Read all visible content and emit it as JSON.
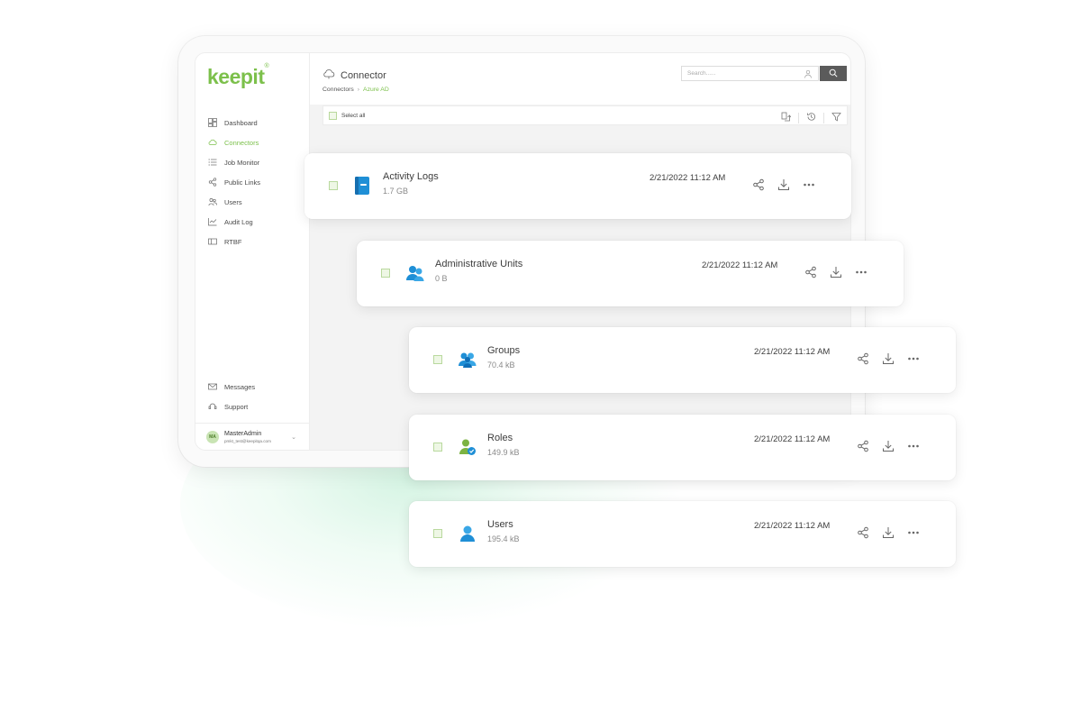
{
  "app": {
    "logo": "keepit",
    "logo_reg": "®"
  },
  "sidebar": {
    "items": [
      {
        "label": "Dashboard",
        "icon": "dashboard-icon",
        "active": false
      },
      {
        "label": "Connectors",
        "icon": "cloud-icon",
        "active": true
      },
      {
        "label": "Job Monitor",
        "icon": "list-icon",
        "active": false
      },
      {
        "label": "Public Links",
        "icon": "share-icon",
        "active": false
      },
      {
        "label": "Users",
        "icon": "users-icon",
        "active": false
      },
      {
        "label": "Audit Log",
        "icon": "audit-icon",
        "active": false
      },
      {
        "label": "RTBF",
        "icon": "rtbf-icon",
        "active": false
      }
    ],
    "bottom_items": [
      {
        "label": "Messages",
        "icon": "mail-icon"
      },
      {
        "label": "Support",
        "icon": "support-icon"
      }
    ],
    "user": {
      "initials": "MA",
      "name": "MasterAdmin",
      "email": "pmkt_test@keepitqa.com"
    }
  },
  "header": {
    "title": "Connector",
    "breadcrumb": [
      "Connectors",
      "Azure AD"
    ],
    "breadcrumb_sep": "›",
    "search_placeholder": "Search......"
  },
  "toolbar": {
    "select_all": "Select all"
  },
  "items": [
    {
      "name": "Activity Logs",
      "size": "1.7 GB",
      "date": "2/21/2022 11:12 AM",
      "icon": "book-icon"
    },
    {
      "name": "Administrative Units",
      "size": "0 B",
      "date": "2/21/2022 11:12 AM",
      "icon": "admin-units-icon"
    },
    {
      "name": "Groups",
      "size": "70.4 kB",
      "date": "2/21/2022 11:12 AM",
      "icon": "groups-icon"
    },
    {
      "name": "Roles",
      "size": "149.9 kB",
      "date": "2/21/2022 11:12 AM",
      "icon": "roles-icon"
    },
    {
      "name": "Users",
      "size": "195.4 kB",
      "date": "2/21/2022 11:12 AM",
      "icon": "user-icon"
    }
  ],
  "colors": {
    "brand_green": "#7cc04b",
    "azure_blue": "#1f8fd6",
    "search_button": "#5b5b5b"
  }
}
